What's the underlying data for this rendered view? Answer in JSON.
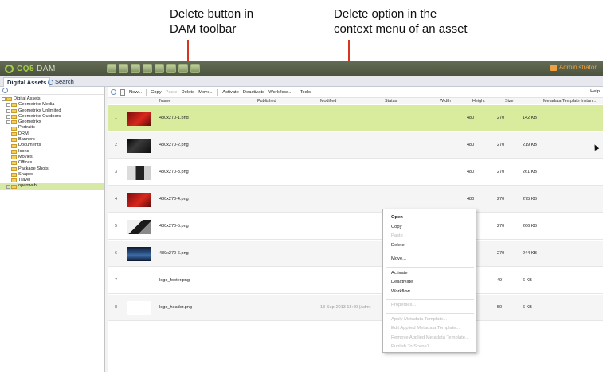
{
  "annotations": {
    "delete_button_line1": "Delete button in",
    "delete_button_line2": "DAM toolbar",
    "delete_option_line1": "Delete option in the",
    "delete_option_line2": "context menu of an asset"
  },
  "colors": {
    "callout_line": "#d6361f",
    "selection_green": "#d9ec9e",
    "header_bar": "#4c5440",
    "brand_green": "#a6cf47"
  },
  "app": {
    "logo_brand": "CQ5",
    "logo_product": "DAM",
    "user": "Administrator",
    "top_app_icons": [
      "websites-icon",
      "digital-assets-icon",
      "campaigns-icon",
      "community-icon",
      "inbox-icon",
      "users-icon",
      "tools-icon",
      "tagging-icon"
    ]
  },
  "tabs": [
    "Digital Assets",
    "Search"
  ],
  "toolbar": {
    "new": "New...",
    "copy": "Copy",
    "paste": "Paste",
    "delete": "Delete",
    "move": "Move...",
    "activate": "Activate",
    "deactivate": "Deactivate",
    "workflow": "Workflow...",
    "tools": "Tools",
    "help": "Help"
  },
  "tree": [
    {
      "label": "Digital Assets",
      "level": 0,
      "selected": false
    },
    {
      "label": "Geometrixx Media",
      "level": 1,
      "selected": false
    },
    {
      "label": "Geometrixx Unlimited",
      "level": 1,
      "selected": false
    },
    {
      "label": "Geometrixx Outdoors",
      "level": 1,
      "selected": false
    },
    {
      "label": "Geometrixx",
      "level": 1,
      "selected": false
    },
    {
      "label": "Portraits",
      "level": 2,
      "selected": false
    },
    {
      "label": "DRM",
      "level": 2,
      "selected": false
    },
    {
      "label": "Banners",
      "level": 2,
      "selected": false
    },
    {
      "label": "Documents",
      "level": 2,
      "selected": false
    },
    {
      "label": "Icons",
      "level": 2,
      "selected": false
    },
    {
      "label": "Movies",
      "level": 2,
      "selected": false
    },
    {
      "label": "Offices",
      "level": 2,
      "selected": false
    },
    {
      "label": "Package Shots",
      "level": 2,
      "selected": false
    },
    {
      "label": "Shapes",
      "level": 2,
      "selected": false
    },
    {
      "label": "Travel",
      "level": 2,
      "selected": false
    },
    {
      "label": "openweb",
      "level": 1,
      "selected": true
    }
  ],
  "grid": {
    "columns": [
      "Name",
      "Published",
      "Modified",
      "Status",
      "Width",
      "Height",
      "Size",
      "Metadata Template Instan..."
    ],
    "rows": [
      {
        "num": "1",
        "thumb": "thumb-red",
        "name": "480x270-1.png",
        "published": "",
        "modified": "",
        "status": "",
        "width": "480",
        "height": "270",
        "size": "142 KB",
        "selected": true
      },
      {
        "num": "2",
        "thumb": "thumb-dark",
        "name": "480x270-2.png",
        "published": "",
        "modified": "",
        "status": "",
        "width": "480",
        "height": "270",
        "size": "219 KB",
        "selected": false
      },
      {
        "num": "3",
        "thumb": "thumb-dark2",
        "name": "480x270-3.png",
        "published": "",
        "modified": "",
        "status": "",
        "width": "480",
        "height": "270",
        "size": "261 KB",
        "selected": false
      },
      {
        "num": "4",
        "thumb": "thumb-red",
        "name": "480x270-4.png",
        "published": "",
        "modified": "",
        "status": "",
        "width": "480",
        "height": "270",
        "size": "275 KB",
        "selected": false
      },
      {
        "num": "5",
        "thumb": "thumb-dark3",
        "name": "480x270-5.png",
        "published": "",
        "modified": "",
        "status": "",
        "width": "480",
        "height": "270",
        "size": "266 KB",
        "selected": false
      },
      {
        "num": "6",
        "thumb": "thumb-blue",
        "name": "480x270-6.png",
        "published": "",
        "modified": "",
        "status": "",
        "width": "480",
        "height": "270",
        "size": "244 KB",
        "selected": false
      },
      {
        "num": "7",
        "thumb": "thumb-white",
        "name": "logo_footer.png",
        "published": "",
        "modified": "",
        "status": "",
        "width": "220",
        "height": "49",
        "size": "6 KB",
        "selected": false
      },
      {
        "num": "8",
        "thumb": "thumb-white",
        "name": "logo_header.png",
        "published": "",
        "modified": "18-Sep-2013 13:40 (Adm)",
        "status": "",
        "width": "230",
        "height": "50",
        "size": "6 KB",
        "selected": false
      }
    ]
  },
  "context_menu": {
    "groups": [
      [
        {
          "label": "Open",
          "enabled": true,
          "bold": true
        },
        {
          "label": "Copy",
          "enabled": true,
          "bold": false
        },
        {
          "label": "Paste",
          "enabled": false,
          "bold": false
        },
        {
          "label": "Delete",
          "enabled": true,
          "bold": false
        }
      ],
      [
        {
          "label": "Move...",
          "enabled": true,
          "bold": false
        }
      ],
      [
        {
          "label": "Activate",
          "enabled": true,
          "bold": false
        },
        {
          "label": "Deactivate",
          "enabled": true,
          "bold": false
        },
        {
          "label": "Workflow...",
          "enabled": true,
          "bold": false
        }
      ],
      [
        {
          "label": "Properties...",
          "enabled": false,
          "bold": false
        }
      ],
      [
        {
          "label": "Apply Metadata Template...",
          "enabled": false,
          "bold": false
        },
        {
          "label": "Edit Applied Metadata Template...",
          "enabled": false,
          "bold": false
        },
        {
          "label": "Remove Applied Metadata Template...",
          "enabled": false,
          "bold": false
        },
        {
          "label": "Publish To Scene7...",
          "enabled": false,
          "bold": false
        }
      ]
    ]
  }
}
